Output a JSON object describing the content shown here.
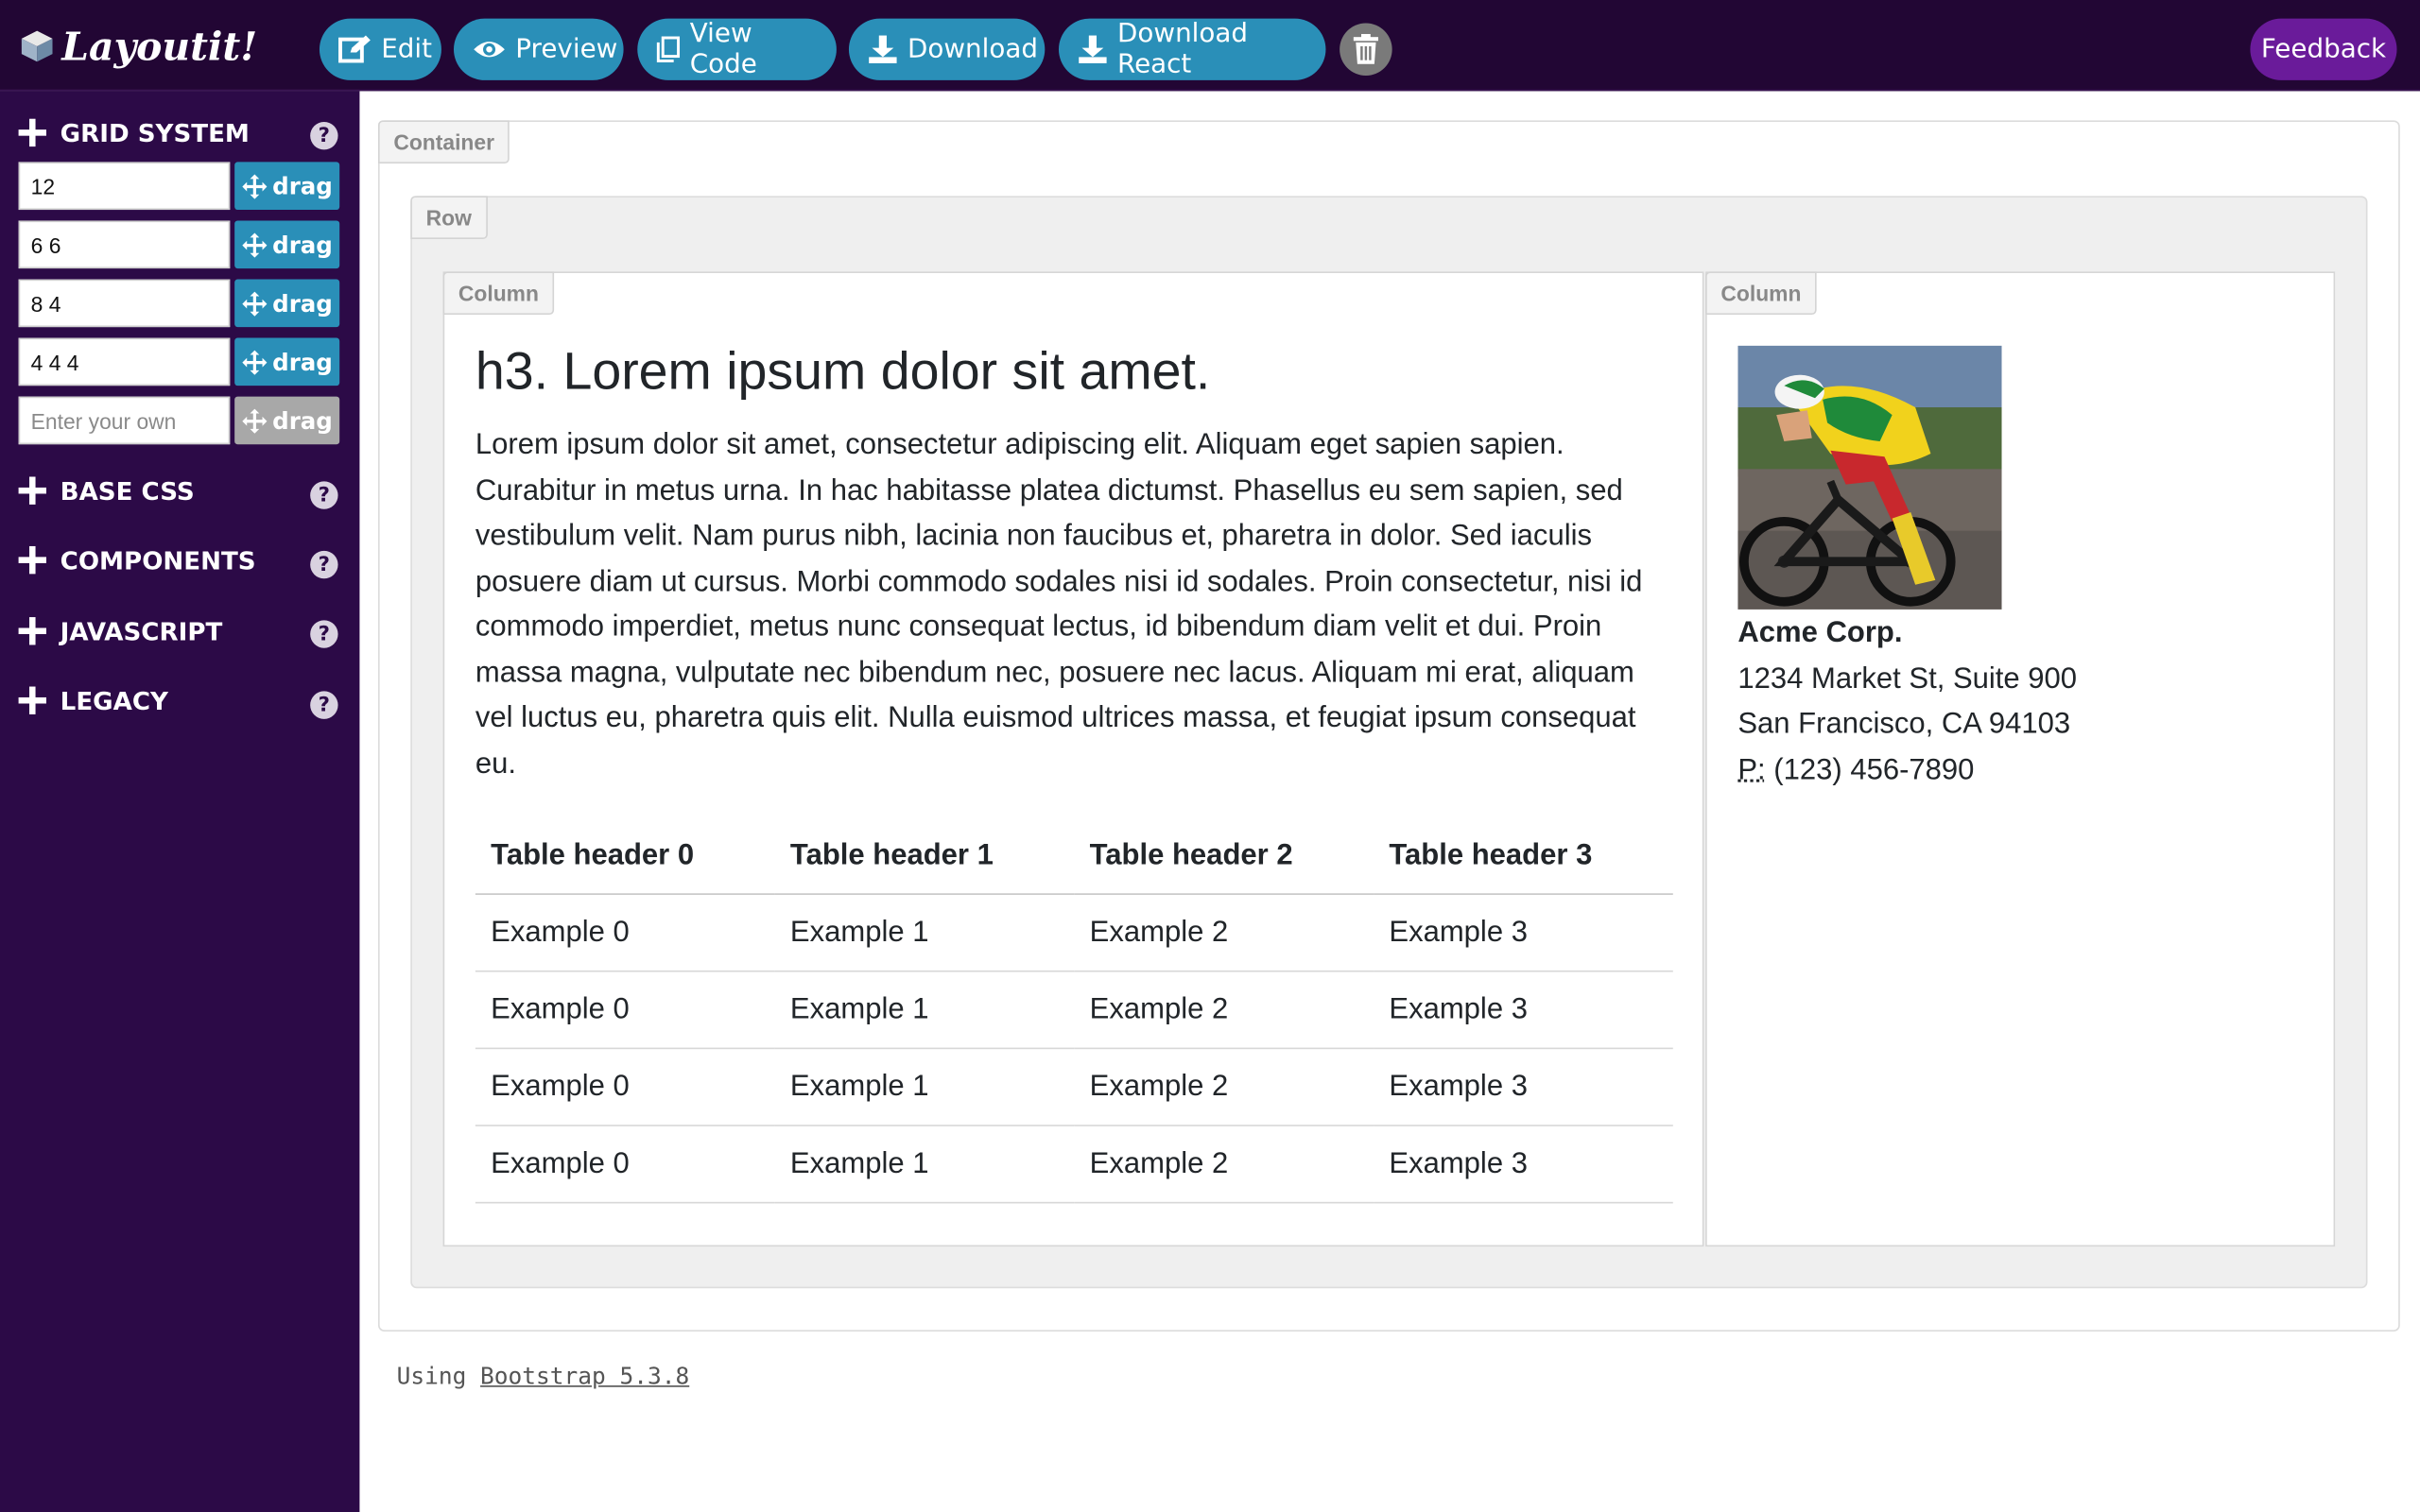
{
  "topbar": {
    "brand": "Layoutit!",
    "buttons": {
      "edit": "Edit",
      "preview": "Preview",
      "view_code": "View Code",
      "download": "Download",
      "download_react": "Download React"
    },
    "feedback": "Feedback"
  },
  "sidebar": {
    "grid_system": {
      "title": "GRID SYSTEM",
      "rows": [
        {
          "value": "12",
          "drag": "drag"
        },
        {
          "value": "6 6",
          "drag": "drag"
        },
        {
          "value": "8 4",
          "drag": "drag"
        },
        {
          "value": "4 4 4",
          "drag": "drag"
        }
      ],
      "custom_placeholder": "Enter your own",
      "custom_drag": "drag"
    },
    "sections": [
      "BASE CSS",
      "COMPONENTS",
      "JAVASCRIPT",
      "LEGACY"
    ],
    "help": "?"
  },
  "canvas": {
    "container_tag": "Container",
    "row_tag": "Row",
    "column_tag": "Column",
    "heading": "h3. Lorem ipsum dolor sit amet.",
    "paragraph": "Lorem ipsum dolor sit amet, consectetur adipiscing elit. Aliquam eget sapien sapien. Curabitur in metus urna. In hac habitasse platea dictumst. Phasellus eu sem sapien, sed vestibulum velit. Nam purus nibh, lacinia non faucibus et, pharetra in dolor. Sed iaculis posuere diam ut cursus. Morbi commodo sodales nisi id sodales. Proin consectetur, nisi id commodo imperdiet, metus nunc consequat lectus, id bibendum diam velit et dui. Proin massa magna, vulputate nec bibendum nec, posuere nec lacus. Aliquam mi erat, aliquam vel luctus eu, pharetra quis elit. Nulla euismod ultrices massa, et feugiat ipsum consequat eu.",
    "table": {
      "headers": [
        "Table header 0",
        "Table header 1",
        "Table header 2",
        "Table header 3"
      ],
      "rows": [
        [
          "Example 0",
          "Example 1",
          "Example 2",
          "Example 3"
        ],
        [
          "Example 0",
          "Example 1",
          "Example 2",
          "Example 3"
        ],
        [
          "Example 0",
          "Example 1",
          "Example 2",
          "Example 3"
        ],
        [
          "Example 0",
          "Example 1",
          "Example 2",
          "Example 3"
        ]
      ]
    },
    "address": {
      "company": "Acme Corp.",
      "line1": "1234 Market St, Suite 900",
      "line2": "San Francisco, CA 94103",
      "phone_label": "P:",
      "phone": "(123) 456-7890"
    }
  },
  "footer": {
    "prefix": "Using",
    "link": "Bootstrap 5.3.8"
  },
  "colors": {
    "topbar_bg": "#220634",
    "sidebar_bg": "#2c0a47",
    "button_blue": "#2a8fb8",
    "feedback_purple": "#6a1b9a"
  }
}
